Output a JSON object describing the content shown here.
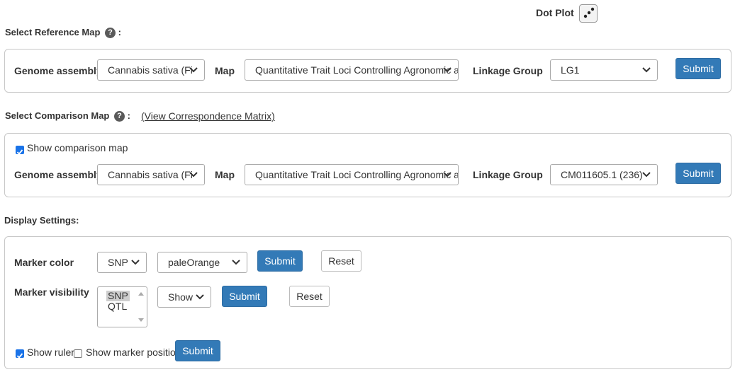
{
  "dot_plot": {
    "label": "Dot Plot"
  },
  "reference": {
    "title": "Select Reference Map",
    "colon": ":",
    "help": "?",
    "genome_label": "Genome assembly",
    "genome_value": "Cannabis sativa (Fi",
    "map_label": "Map",
    "map_value": "Quantitative Trait Loci Controlling Agronomic a",
    "lg_label": "Linkage Group",
    "lg_value": "LG1",
    "submit": "Submit"
  },
  "comparison": {
    "title": "Select Comparison Map",
    "colon": ":",
    "help": "?",
    "matrix_link": "(View Correspondence Matrix)",
    "show_label": "Show comparison map",
    "show_checked": true,
    "genome_label": "Genome assembly",
    "genome_value": "Cannabis sativa (Fi",
    "map_label": "Map",
    "map_value": "Quantitative Trait Loci Controlling Agronomic a",
    "lg_label": "Linkage Group",
    "lg_value": "CM011605.1 (236)",
    "submit": "Submit"
  },
  "display": {
    "title": "Display Settings:",
    "marker_color_label": "Marker color",
    "marker_type_value": "SNP",
    "color_value": "paleOrange",
    "color_submit": "Submit",
    "color_reset": "Reset",
    "visibility_label": "Marker visibility",
    "visibility_options": [
      "SNP",
      "QTL"
    ],
    "visibility_selected": "SNP",
    "visibility_value": "Show",
    "visibility_submit": "Submit",
    "visibility_reset": "Reset",
    "ruler_label": "Show ruler",
    "ruler_checked": true,
    "position_label": "Show marker position",
    "position_checked": false,
    "bottom_submit": "Submit"
  },
  "colors": {
    "primary": "#337ab7",
    "checkbox": "#1a73e8",
    "border": "#c8c8c8"
  }
}
